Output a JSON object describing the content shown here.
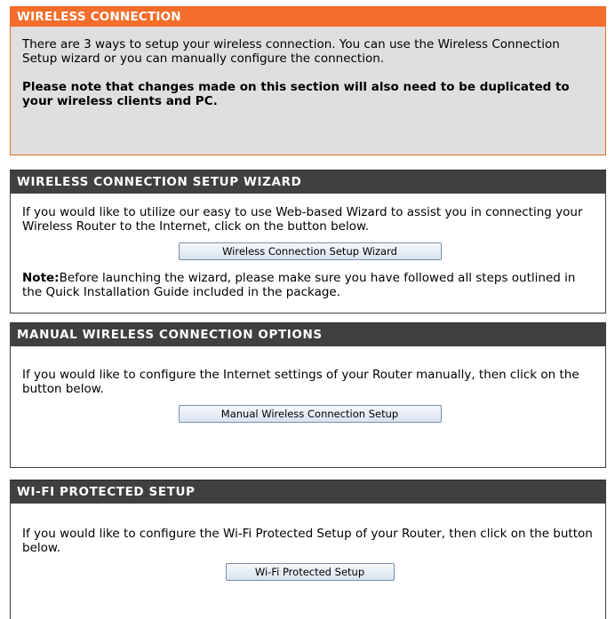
{
  "intro": {
    "title": "WIRELESS CONNECTION",
    "text": "There are 3 ways to setup your wireless connection. You can use the Wireless Connection Setup wizard or you can manually configure the connection.",
    "note": "Please note that changes made on this section will also need to be duplicated to your wireless clients and PC."
  },
  "wizard": {
    "title": "WIRELESS CONNECTION SETUP WIZARD",
    "text": "If you would like to utilize our easy to use Web-based Wizard to assist you in connecting your Wireless Router to the Internet, click on the button below.",
    "button_label": "Wireless Connection Setup Wizard",
    "note_label": "Note:",
    "note_text": "Before launching the wizard, please make sure you have followed all steps outlined in the Quick Installation Guide included in the package."
  },
  "manual": {
    "title": "MANUAL WIRELESS CONNECTION OPTIONS",
    "text": "If you would like to configure the Internet settings of your Router manually, then click on the button below.",
    "button_label": "Manual Wireless Connection Setup"
  },
  "wps": {
    "title": "WI-FI PROTECTED SETUP",
    "text": "If you would like to configure the Wi-Fi Protected Setup of your Router, then click on the button below.",
    "button_label": "Wi-Fi Protected Setup"
  },
  "colors": {
    "orange_header": "#f26e2a",
    "dark_header": "#404040",
    "intro_background": "#dfdfdf"
  }
}
